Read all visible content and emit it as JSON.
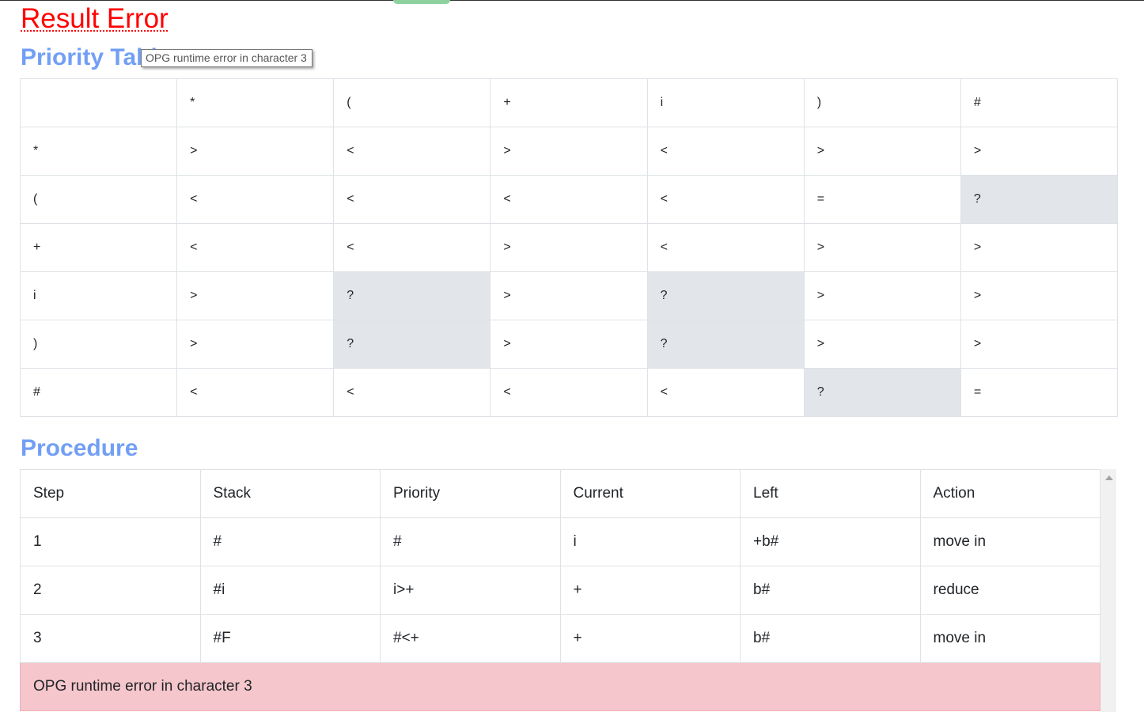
{
  "result_title": "Result Error",
  "priority_title": "Priority Table",
  "tooltip_text": "OPG runtime error in character 3",
  "priority_table": {
    "header": [
      "",
      "*",
      "(",
      "+",
      "i",
      ")",
      "#"
    ],
    "rows": [
      [
        "*",
        ">",
        "<",
        ">",
        "<",
        ">",
        ">"
      ],
      [
        "(",
        "<",
        "<",
        "<",
        "<",
        "=",
        "?"
      ],
      [
        "+",
        "<",
        "<",
        ">",
        "<",
        ">",
        ">"
      ],
      [
        "i",
        ">",
        "?",
        ">",
        "?",
        ">",
        ">"
      ],
      [
        ")",
        ">",
        "?",
        ">",
        "?",
        ">",
        ">"
      ],
      [
        "#",
        "<",
        "<",
        "<",
        "<",
        "?",
        "="
      ]
    ]
  },
  "procedure_title": "Procedure",
  "procedure_table": {
    "header": [
      "Step",
      "Stack",
      "Priority",
      "Current",
      "Left",
      "Action"
    ],
    "rows": [
      [
        "1",
        "#",
        "#",
        "i",
        "+b#",
        "move in"
      ],
      [
        "2",
        "#i",
        "i>+",
        "+",
        "b#",
        "reduce"
      ],
      [
        "3",
        "#F",
        "#<+",
        "+",
        "b#",
        "move in"
      ]
    ],
    "error_message": "OPG runtime error in character 3"
  },
  "colors": {
    "result_error": "#ff0000",
    "section_title": "#729ff5",
    "unknown_cell": "#e2e6ea",
    "error_row": "#f5c6cb"
  }
}
